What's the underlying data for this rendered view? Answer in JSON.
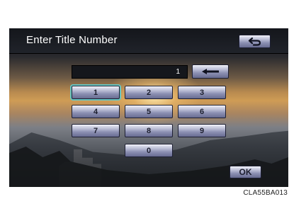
{
  "header": {
    "title": "Enter Title Number",
    "back_icon": "return-arrow-icon"
  },
  "display": {
    "value": "1",
    "backspace_icon": "left-arrow-icon"
  },
  "keypad": {
    "keys": [
      "1",
      "2",
      "3",
      "4",
      "5",
      "6",
      "7",
      "8",
      "9",
      "0"
    ],
    "focused_key": "1"
  },
  "footer": {
    "ok_label": "OK"
  },
  "caption": "CLA55BA013",
  "colors": {
    "button_base": "#8e92b4",
    "focus_outline": "#67c4c0",
    "titlebar": "#1a1c22"
  }
}
